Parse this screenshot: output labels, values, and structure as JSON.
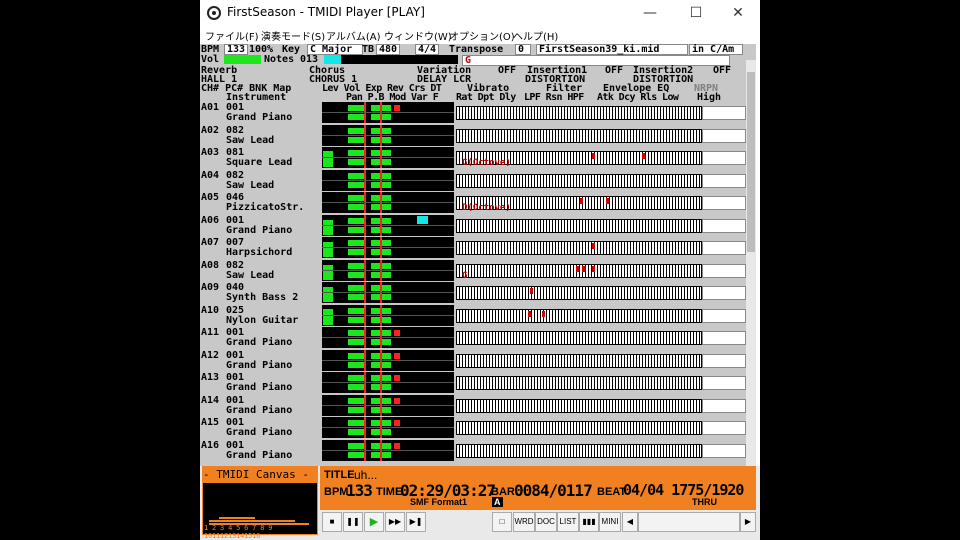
{
  "window": {
    "title": "FirstSeason - TMIDI Player [PLAY]",
    "minimize": "—",
    "maximize": "☐",
    "close": "✕"
  },
  "menu": [
    "ファイル(F)",
    "演奏モード(S)",
    "アルバム(A)",
    "ウィンドウ(W)",
    "オプション(O)",
    "ヘルプ(H)"
  ],
  "status": {
    "bpm_label": "BPM",
    "bpm_value": "133",
    "bpm_pct": "100%",
    "key_label": "Key",
    "key_value": "C Major",
    "tb_label": "TB",
    "tb_value": "480",
    "timesig": "4/4",
    "transpose_label": "Transpose",
    "transpose_value": "0",
    "file": "FirstSeason39_ki.mid",
    "mode": "in C/Am",
    "vol_label": "Vol",
    "notes_label": "Notes",
    "notes_value": "013",
    "note_name": "G",
    "note_fill": 0.13
  },
  "effects": {
    "reverb_label": "Reverb",
    "reverb_value": "HALL 1",
    "chorus_label": "Chorus",
    "chorus_value": "CHORUS 1",
    "variation_label": "Variation",
    "variation_type": "DELAY LCR",
    "variation_state": "OFF",
    "insertion1_label": "Insertion1",
    "insertion1_type": "DISTORTION",
    "insertion1_state": "OFF",
    "insertion2_label": "Insertion2",
    "insertion2_type": "DISTORTION",
    "insertion2_state": "OFF"
  },
  "headers": {
    "line1": "CH# PC# BNK Map",
    "line2": "Instrument",
    "params1": "Lev Vol Exp Rev Crs DT",
    "params2": "Pan P.B Mod Var F",
    "vibrato": "Vibrato",
    "vibrato_sub": "Rat Dpt Dly",
    "filter": "Filter",
    "filter_sub": "LPF Rsn HPF",
    "envelope": "Envelope EQ",
    "envelope_sub": "Atk Dcy Rls Low",
    "nrpn": "NRPN",
    "nrpn_sub": "High"
  },
  "channels": [
    {
      "ch": "A01",
      "pc": "001",
      "name": "Grand Piano",
      "lev": 0,
      "vol": 0.85,
      "exp": 0.85,
      "rev": 0.35,
      "crs": 0,
      "note_label": ""
    },
    {
      "ch": "A02",
      "pc": "082",
      "name": "Saw Lead",
      "lev": 0,
      "vol": 0.85,
      "exp": 0.85,
      "rev": 0,
      "crs": 0,
      "note_label": ""
    },
    {
      "ch": "A03",
      "pc": "081",
      "name": "Square Lead",
      "lev": 0.85,
      "vol": 0.85,
      "exp": 0.85,
      "rev": 0,
      "crs": 0,
      "note_label": "G(Octove)"
    },
    {
      "ch": "A04",
      "pc": "082",
      "name": "Saw Lead",
      "lev": 0,
      "vol": 0.85,
      "exp": 0.85,
      "rev": 0,
      "crs": 0,
      "note_label": ""
    },
    {
      "ch": "A05",
      "pc": "046",
      "name": "PizzicatoStr.",
      "lev": 0,
      "vol": 0.85,
      "exp": 0.85,
      "rev": 0,
      "crs": 0,
      "note_label": "D(Octove)"
    },
    {
      "ch": "A06",
      "pc": "001",
      "name": "Grand Piano",
      "lev": 0.8,
      "vol": 0.85,
      "exp": 0.85,
      "rev": 0,
      "crs": 0.7,
      "note_label": ""
    },
    {
      "ch": "A07",
      "pc": "007",
      "name": "Harpsichord",
      "lev": 0.8,
      "vol": 0.85,
      "exp": 0.85,
      "rev": 0,
      "crs": 0,
      "note_label": ""
    },
    {
      "ch": "A08",
      "pc": "082",
      "name": "Saw Lead",
      "lev": 0.8,
      "vol": 0.85,
      "exp": 0.85,
      "rev": 0,
      "crs": 0,
      "note_label": "G"
    },
    {
      "ch": "A09",
      "pc": "040",
      "name": "Synth Bass 2",
      "lev": 0.8,
      "vol": 0.85,
      "exp": 0.85,
      "rev": 0,
      "crs": 0,
      "note_label": ""
    },
    {
      "ch": "A10",
      "pc": "025",
      "name": "Nylon Guitar",
      "lev": 0.85,
      "vol": 0.85,
      "exp": 0.85,
      "rev": 0,
      "crs": 0,
      "note_label": ""
    },
    {
      "ch": "A11",
      "pc": "001",
      "name": "Grand Piano",
      "lev": 0,
      "vol": 0.85,
      "exp": 0.85,
      "rev": 0.35,
      "crs": 0,
      "note_label": ""
    },
    {
      "ch": "A12",
      "pc": "001",
      "name": "Grand Piano",
      "lev": 0,
      "vol": 0.85,
      "exp": 0.85,
      "rev": 0.35,
      "crs": 0,
      "note_label": ""
    },
    {
      "ch": "A13",
      "pc": "001",
      "name": "Grand Piano",
      "lev": 0,
      "vol": 0.85,
      "exp": 0.85,
      "rev": 0.35,
      "crs": 0,
      "note_label": ""
    },
    {
      "ch": "A14",
      "pc": "001",
      "name": "Grand Piano",
      "lev": 0,
      "vol": 0.85,
      "exp": 0.85,
      "rev": 0.35,
      "crs": 0,
      "note_label": ""
    },
    {
      "ch": "A15",
      "pc": "001",
      "name": "Grand Piano",
      "lev": 0,
      "vol": 0.85,
      "exp": 0.85,
      "rev": 0.35,
      "crs": 0,
      "note_label": ""
    },
    {
      "ch": "A16",
      "pc": "001",
      "name": "Grand Piano",
      "lev": 0,
      "vol": 0.85,
      "exp": 0.85,
      "rev": 0.35,
      "crs": 0,
      "note_label": ""
    }
  ],
  "canvas": {
    "title": "- TMIDI Canvas -",
    "numbers": "1 2 3 4 5 6 7 8 9 10111213141516"
  },
  "panel": {
    "title_label": "TITLE",
    "title_value": "uh...",
    "bpm_label": "BPM",
    "bpm_value": "133",
    "time_label": "TIME",
    "time_value": "02:29/03:27",
    "bar_label": "BAR",
    "bar_value": "0084/0117",
    "beat_label": "BEAT",
    "beat_value": "04/04 1775/1920",
    "format": "SMF Format1",
    "format_badge": "A",
    "thru": "THRU"
  },
  "controls": {
    "stop": "■",
    "pause": "❚❚",
    "play": "▶",
    "forward": "▶▶",
    "next": "▶❚",
    "square": "□",
    "wrd": "WRD",
    "doc": "DOC",
    "list": "LIST",
    "bars": "▮▮▮",
    "mini": "MINI",
    "left": "◀",
    "right": "▶"
  }
}
